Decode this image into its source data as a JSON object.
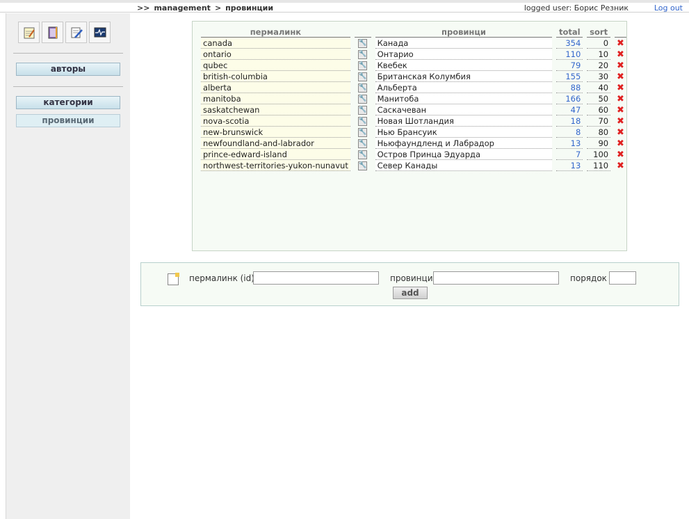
{
  "header": {
    "crumb_prefix": ">>",
    "crumb_section": "management",
    "crumb_sep": ">",
    "crumb_page": "провинции",
    "user_text": "logged user: Борис Резник",
    "logout_label": "Log out"
  },
  "sidebar": {
    "tools": [
      "notepad-icon",
      "book-icon",
      "edit-document-icon",
      "monitor-icon"
    ],
    "authors_label": "авторы",
    "categories_label": "категории",
    "provinces_label": "провинции"
  },
  "table": {
    "headers": {
      "permalink": "пермалинк",
      "province": "провинци",
      "total": "total",
      "sort": "sort"
    },
    "rows": [
      {
        "permalink": "canada",
        "name": "Канада",
        "total": "354",
        "sort": "0"
      },
      {
        "permalink": "ontario",
        "name": "Онтарио",
        "total": "110",
        "sort": "10"
      },
      {
        "permalink": "qubec",
        "name": "Квебек",
        "total": "79",
        "sort": "20"
      },
      {
        "permalink": "british-columbia",
        "name": "Британская Колумбия",
        "total": "155",
        "sort": "30"
      },
      {
        "permalink": "alberta",
        "name": "Альберта",
        "total": "88",
        "sort": "40"
      },
      {
        "permalink": "manitoba",
        "name": "Манитоба",
        "total": "166",
        "sort": "50"
      },
      {
        "permalink": "saskatchewan",
        "name": "Саскачеван",
        "total": "47",
        "sort": "60"
      },
      {
        "permalink": "nova-scotia",
        "name": "Новая Шотландия",
        "total": "18",
        "sort": "70"
      },
      {
        "permalink": "new-brunswick",
        "name": "Нью Брансуик",
        "total": "8",
        "sort": "80"
      },
      {
        "permalink": "newfoundland-and-labrador",
        "name": "Ньюфаундленд и Лабрадор",
        "total": "13",
        "sort": "90"
      },
      {
        "permalink": "prince-edward-island",
        "name": "Остров Принца Эдуарда",
        "total": "7",
        "sort": "100"
      },
      {
        "permalink": "northwest-territories-yukon-nunavut",
        "name": "Север Канады",
        "total": "13",
        "sort": "110"
      }
    ]
  },
  "form": {
    "permalink_label": "пермалинк (id)",
    "province_label": "провинци",
    "order_label": "порядок",
    "add_label": "add"
  },
  "colors": {
    "link": "#3366cc",
    "delete": "#e02020"
  }
}
